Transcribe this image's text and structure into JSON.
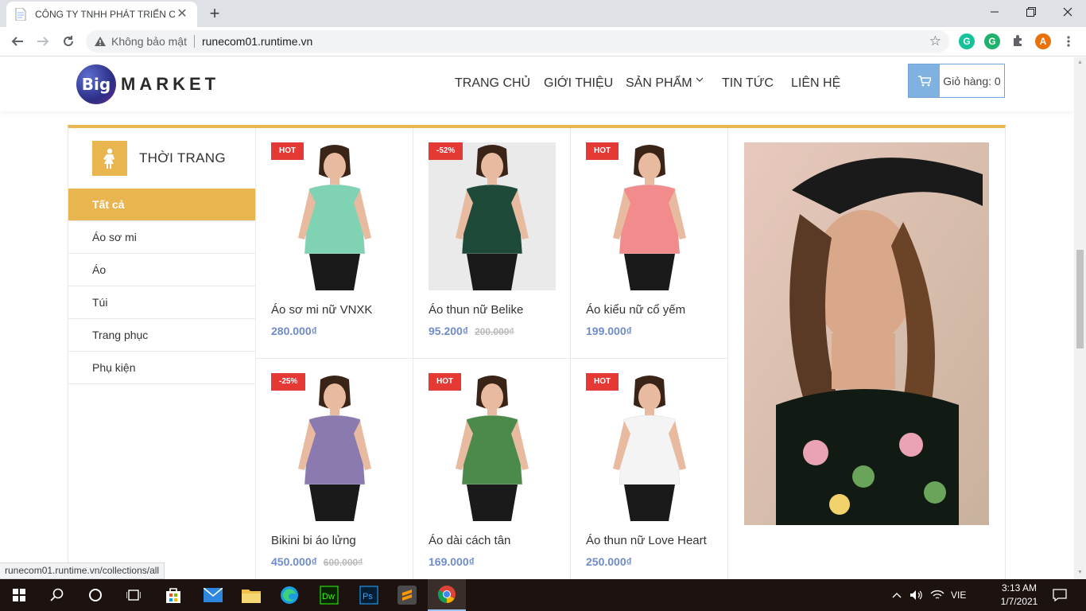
{
  "browser": {
    "tab_title": "CÔNG TY TNHH PHÁT TRIỂN CÔ",
    "tab_close": "✕",
    "new_tab": "+",
    "security_label": "Không bảo mật",
    "url": "runecom01.runtime.vn",
    "status_url": "runecom01.runtime.vn/collections/all",
    "extensions": [
      {
        "name": "grammarly",
        "letter": "G",
        "color": "#15c39a"
      },
      {
        "name": "grammarly-2",
        "letter": "G",
        "color": "#1eb26c"
      },
      {
        "name": "profile",
        "letter": "A",
        "color": "#e8710a"
      }
    ]
  },
  "site": {
    "logo_mark": "Big",
    "logo_word": "MARKET",
    "nav": [
      "TRANG CHỦ",
      "GIỚI THIỆU",
      "SẢN PHẨM",
      "TIN TỨC",
      "LIÊN HỆ"
    ],
    "cart_label": "Giỏ hàng: 0"
  },
  "category": {
    "title": "THỜI TRANG",
    "items": [
      "Tất cả",
      "Áo sơ mi",
      "Áo",
      "Túi",
      "Trang phục",
      "Phụ kiện"
    ],
    "active_index": 0
  },
  "products": [
    {
      "name": "Áo sơ mi nữ VNXK",
      "price": "280.000₫",
      "old_price": "",
      "badge": "HOT",
      "color": "#7fd3b3"
    },
    {
      "name": "Áo thun nữ Belike",
      "price": "95.200₫",
      "old_price": "200.000₫",
      "badge": "-52%",
      "color": "#1f4a3a"
    },
    {
      "name": "Áo kiểu nữ cổ yếm",
      "price": "199.000₫",
      "old_price": "",
      "badge": "HOT",
      "color": "#f28b8b"
    },
    {
      "name": "Bikini bi áo lửng",
      "price": "450.000₫",
      "old_price": "600.000₫",
      "badge": "-25%",
      "color": "#8a7ab0"
    },
    {
      "name": "Áo dài cách tân",
      "price": "169.000₫",
      "old_price": "",
      "badge": "HOT",
      "color": "#4c8a4c"
    },
    {
      "name": "Áo thun nữ Love Heart",
      "price": "250.000₫",
      "old_price": "",
      "badge": "HOT",
      "color": "#f4f4f4"
    }
  ],
  "taskbar": {
    "language": "VIE",
    "time": "3:13 AM",
    "date": "1/7/2021"
  }
}
